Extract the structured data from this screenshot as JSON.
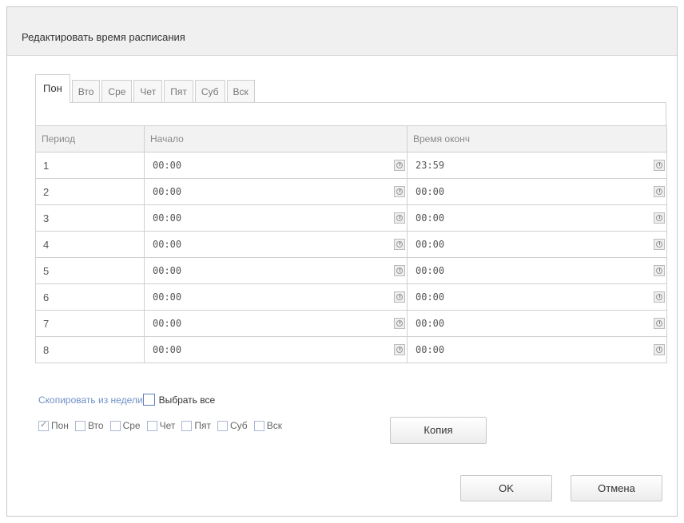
{
  "dialog": {
    "title": "Редактировать время расписания"
  },
  "tabs": [
    {
      "label": "Пон",
      "active": true
    },
    {
      "label": "Вто",
      "active": false
    },
    {
      "label": "Сре",
      "active": false
    },
    {
      "label": "Чет",
      "active": false
    },
    {
      "label": "Пят",
      "active": false
    },
    {
      "label": "Суб",
      "active": false
    },
    {
      "label": "Вск",
      "active": false
    }
  ],
  "table": {
    "headers": [
      "Период",
      "Начало",
      "Время оконч"
    ],
    "rows": [
      {
        "period": "1",
        "start": "00:00",
        "end": "23:59"
      },
      {
        "period": "2",
        "start": "00:00",
        "end": "00:00"
      },
      {
        "period": "3",
        "start": "00:00",
        "end": "00:00"
      },
      {
        "period": "4",
        "start": "00:00",
        "end": "00:00"
      },
      {
        "period": "5",
        "start": "00:00",
        "end": "00:00"
      },
      {
        "period": "6",
        "start": "00:00",
        "end": "00:00"
      },
      {
        "period": "7",
        "start": "00:00",
        "end": "00:00"
      },
      {
        "period": "8",
        "start": "00:00",
        "end": "00:00"
      }
    ]
  },
  "copy": {
    "link_label": "Скопировать из недели",
    "select_all_label": "Выбрать все",
    "days": [
      {
        "label": "Пон",
        "checked": true
      },
      {
        "label": "Вто",
        "checked": false
      },
      {
        "label": "Сре",
        "checked": false
      },
      {
        "label": "Чет",
        "checked": false
      },
      {
        "label": "Пят",
        "checked": false
      },
      {
        "label": "Суб",
        "checked": false
      },
      {
        "label": "Вск",
        "checked": false
      }
    ],
    "button_label": "Копия"
  },
  "buttons": {
    "ok": "OK",
    "cancel": "Отмена"
  },
  "icons": {
    "time_picker": "clock-icon"
  }
}
